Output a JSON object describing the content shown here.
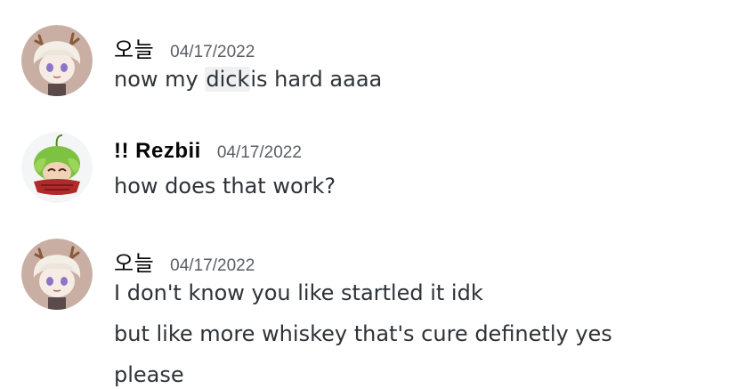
{
  "messages": [
    {
      "author": "오늘",
      "timestamp": "04/17/2022",
      "avatar_icon": "antlered-white-hair-avatar-icon",
      "lines": [
        {
          "highlighted_prefix": "",
          "pre": "now my ",
          "highlight": "dick",
          "post": "is hard aaaa"
        }
      ]
    },
    {
      "author": "!! Rezbii",
      "timestamp": "04/17/2022",
      "avatar_icon": "green-hair-avatar-icon",
      "lines": [
        {
          "text": "how does that work?"
        }
      ]
    },
    {
      "author": "오늘",
      "timestamp": "04/17/2022",
      "avatar_icon": "antlered-white-hair-avatar-icon",
      "lines": [
        {
          "text": "I don't know you like startled it idk"
        },
        {
          "text": "but like more whiskey that's cure definetly yes"
        },
        {
          "text": "please"
        }
      ]
    }
  ],
  "colors": {
    "background": "#ffffff",
    "text": "#2e3338",
    "username": "#060607",
    "timestamp": "#5c5e66",
    "highlight": "#eef0f2"
  }
}
